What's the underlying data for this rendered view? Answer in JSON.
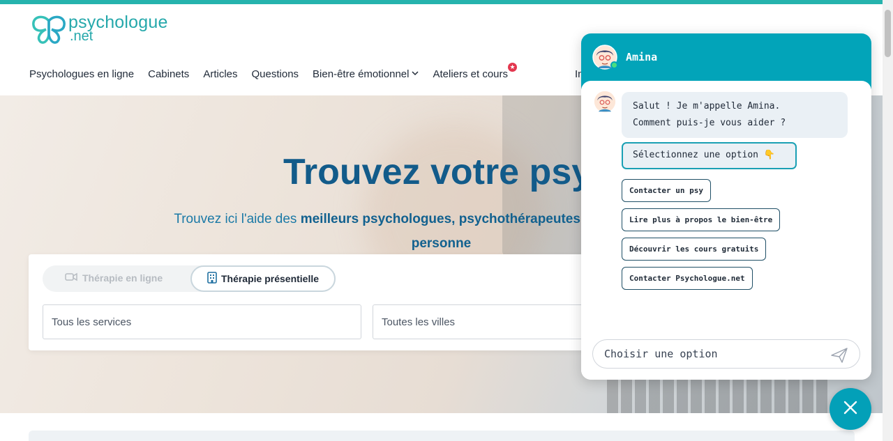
{
  "header": {
    "logo": {
      "line1": "psychologue",
      "line2": ".net"
    },
    "nav": [
      {
        "label": "Psychologues en ligne"
      },
      {
        "label": "Cabinets"
      },
      {
        "label": "Articles"
      },
      {
        "label": "Questions"
      },
      {
        "label": "Bien-être émotionnel",
        "has_dropdown": true
      },
      {
        "label": "Ateliers et cours",
        "badge": "★"
      }
    ],
    "nav_partial": "In"
  },
  "hero": {
    "title": "Trouvez votre psy",
    "subtitle_pre": "Trouvez ici l'aide des ",
    "subtitle_bold": "meilleurs psychologues, psychothérapeutes et psychopraticiens",
    "subtitle_line2": "personne"
  },
  "search": {
    "tab_online": "Thérapie en ligne",
    "tab_presential": "Thérapie présentielle",
    "services_placeholder": "Tous les services",
    "cities_placeholder": "Toutes les villes"
  },
  "chat": {
    "agent_name": "Amina",
    "status": "online",
    "greeting_line1": "Salut ! Je m'appelle Amina.",
    "greeting_line2": "Comment puis-je vous aider ?",
    "select_prompt": "Sélectionnez une option 👇",
    "options": [
      "Contacter un psy",
      "Lire plus à propos le bien-être",
      "Découvrir les cours gratuits",
      "Contacter Psychologue.net"
    ],
    "input_placeholder": "Choisir une option"
  },
  "colors": {
    "brand_teal": "#26b3ad",
    "chat_header": "#02a4b9",
    "hero_title": "#125b8a",
    "badge_red": "#e3374f"
  }
}
